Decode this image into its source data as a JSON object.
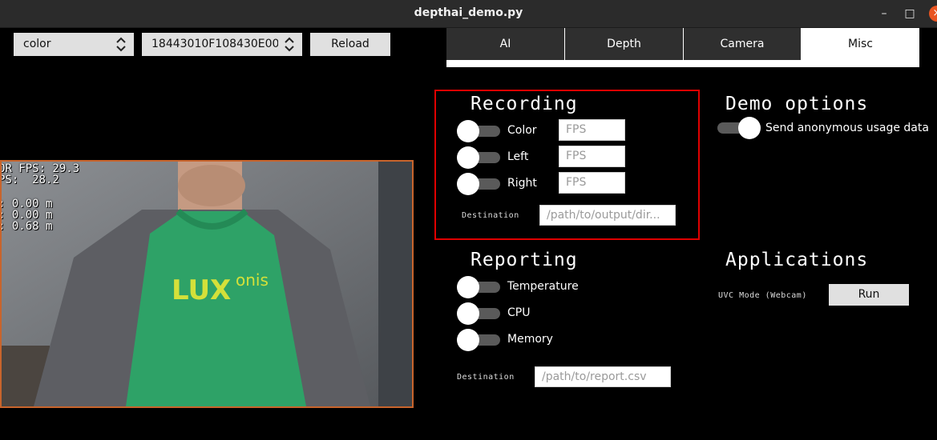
{
  "window": {
    "title": "depthai_demo.py",
    "minimize": "–",
    "maximize": "□",
    "close": "×"
  },
  "toolbar": {
    "camera_select": "color",
    "device_select": "18443010F108430E00",
    "reload_label": "Reload"
  },
  "tabs": [
    {
      "label": "AI",
      "active": false
    },
    {
      "label": "Depth",
      "active": false
    },
    {
      "label": "Camera",
      "active": false
    },
    {
      "label": "Misc",
      "active": true
    }
  ],
  "preview": {
    "fps_lines": "OR FPS: 29.3\nPS:  28.2",
    "depth_lines": ": 0.00 m\n: 0.00 m\n: 0.68 m"
  },
  "recording": {
    "title": "Recording",
    "rows": [
      {
        "label": "Color",
        "placeholder": "FPS",
        "on": false
      },
      {
        "label": "Left",
        "placeholder": "FPS",
        "on": false
      },
      {
        "label": "Right",
        "placeholder": "FPS",
        "on": false
      }
    ],
    "destination_label": "Destination",
    "destination_placeholder": "/path/to/output/dir..."
  },
  "demo_options": {
    "title": "Demo options",
    "usage_label": "Send anonymous usage data",
    "usage_on": true
  },
  "reporting": {
    "title": "Reporting",
    "rows": [
      {
        "label": "Temperature",
        "on": false
      },
      {
        "label": "CPU",
        "on": false
      },
      {
        "label": "Memory",
        "on": false
      }
    ],
    "destination_label": "Destination",
    "destination_placeholder": "/path/to/report.csv"
  },
  "applications": {
    "title": "Applications",
    "uvc_label": "UVC Mode (Webcam)",
    "run_label": "Run"
  },
  "colors": {
    "highlight": "#e00000",
    "video_border": "#c8642c",
    "close_button": "#e95420"
  }
}
